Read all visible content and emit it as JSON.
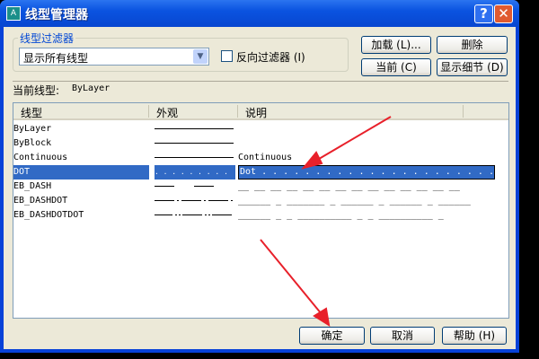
{
  "title": "线型管理器",
  "help_btn": "?",
  "close_btn": "✕",
  "filter": {
    "group_label": "线型过滤器",
    "selected": "显示所有线型",
    "invert_label": "反向过滤器 (I)"
  },
  "buttons": {
    "load": "加载 (L)...",
    "delete": "删除",
    "current": "当前 (C)",
    "details": "显示细节 (D)",
    "ok": "确定",
    "cancel": "取消",
    "help": "帮助 (H)"
  },
  "current_linetype": {
    "label": "当前线型:",
    "value": "ByLayer"
  },
  "table": {
    "headers": [
      "线型",
      "外观",
      "说明"
    ],
    "rows": [
      {
        "name": "ByLayer",
        "appearance": "solid",
        "description": ""
      },
      {
        "name": "ByBlock",
        "appearance": "solid",
        "description": ""
      },
      {
        "name": "Continuous",
        "appearance": "solid",
        "description": "Continuous"
      },
      {
        "name": "DOT",
        "appearance": "dot",
        "description": "Dot . . . . . . . . . . . . . . . . . . . . . . . . . . . . . .",
        "selected": true
      },
      {
        "name": "EB_DASH",
        "appearance": "dash",
        "description": "__ __ __ __ __ __ __ __ __ __ __ __ __ __"
      },
      {
        "name": "EB_DASHDOT",
        "appearance": "dashdot",
        "description": "______ _ _______ _ ______ _ ______ _ ______"
      },
      {
        "name": "EB_DASHDOTDOT",
        "appearance": "dashdotdot",
        "description": "______ _ _ __________ _ _ __________ _"
      }
    ]
  },
  "colors": {
    "selection": "#316ac5",
    "arrow": "#e8202a"
  }
}
